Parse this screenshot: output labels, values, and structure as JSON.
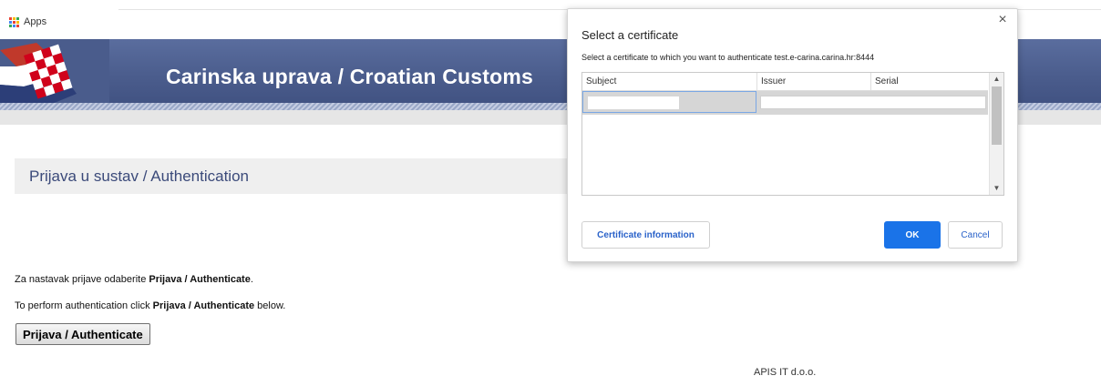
{
  "bookmarks": {
    "apps_label": "Apps",
    "apps_icon": "apps-grid-icon",
    "apps_colors": [
      "#ea4335",
      "#fbbc05",
      "#34a853",
      "#4285f4",
      "#ea4335",
      "#fbbc05",
      "#34a853",
      "#4285f4",
      "#ea4335"
    ]
  },
  "banner": {
    "title": "Carinska uprava / Croatian Customs",
    "logo_icon": "croatian-checkerboard-flag-icon",
    "background_color": "#4a5c8c"
  },
  "page": {
    "section_title": "Prijava u sustav / Authentication",
    "instruction_hr_prefix": "Za nastavak prijave odaberite ",
    "instruction_hr_bold": "Prijava / Authenticate",
    "instruction_hr_suffix": ".",
    "instruction_en_prefix": "To perform authentication click ",
    "instruction_en_bold": "Prijava / Authenticate",
    "instruction_en_suffix": " below.",
    "button_label": "Prijava / Authenticate",
    "footer": "APIS IT d.o.o."
  },
  "dialog": {
    "title": "Select a certificate",
    "close_icon": "close-icon",
    "close_glyph": "×",
    "subtitle": "Select a certificate to which you want to authenticate test.e-carina.carina.hr:8444",
    "columns": [
      "Subject",
      "Issuer",
      "Serial"
    ],
    "scroll_up_glyph": "▲",
    "scroll_down_glyph": "▼",
    "certificate_info_button": "Certificate information",
    "ok_button": "OK",
    "cancel_button": "Cancel",
    "accent_color": "#1a73e8"
  }
}
